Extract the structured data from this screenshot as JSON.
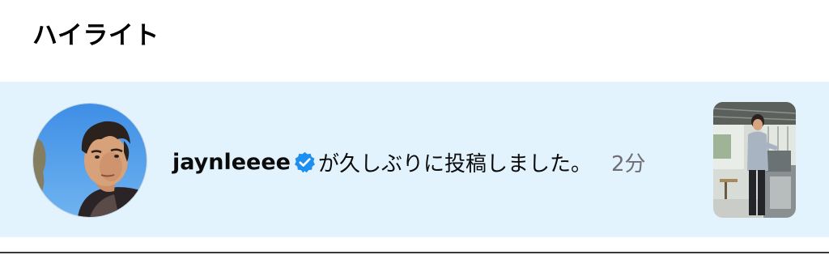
{
  "section": {
    "title": "ハイライト"
  },
  "notification": {
    "username": "jaynleeee",
    "verified_icon": "verified-badge-icon",
    "message": "が久しぶりに投稿しました。",
    "time": "2分",
    "avatar": "profile-photo",
    "thumbnail": "post-photo-thumbnail"
  },
  "colors": {
    "row_background": "#e3f3fd",
    "verified_blue": "#1d8ff0",
    "time_gray": "#6e6e73"
  }
}
